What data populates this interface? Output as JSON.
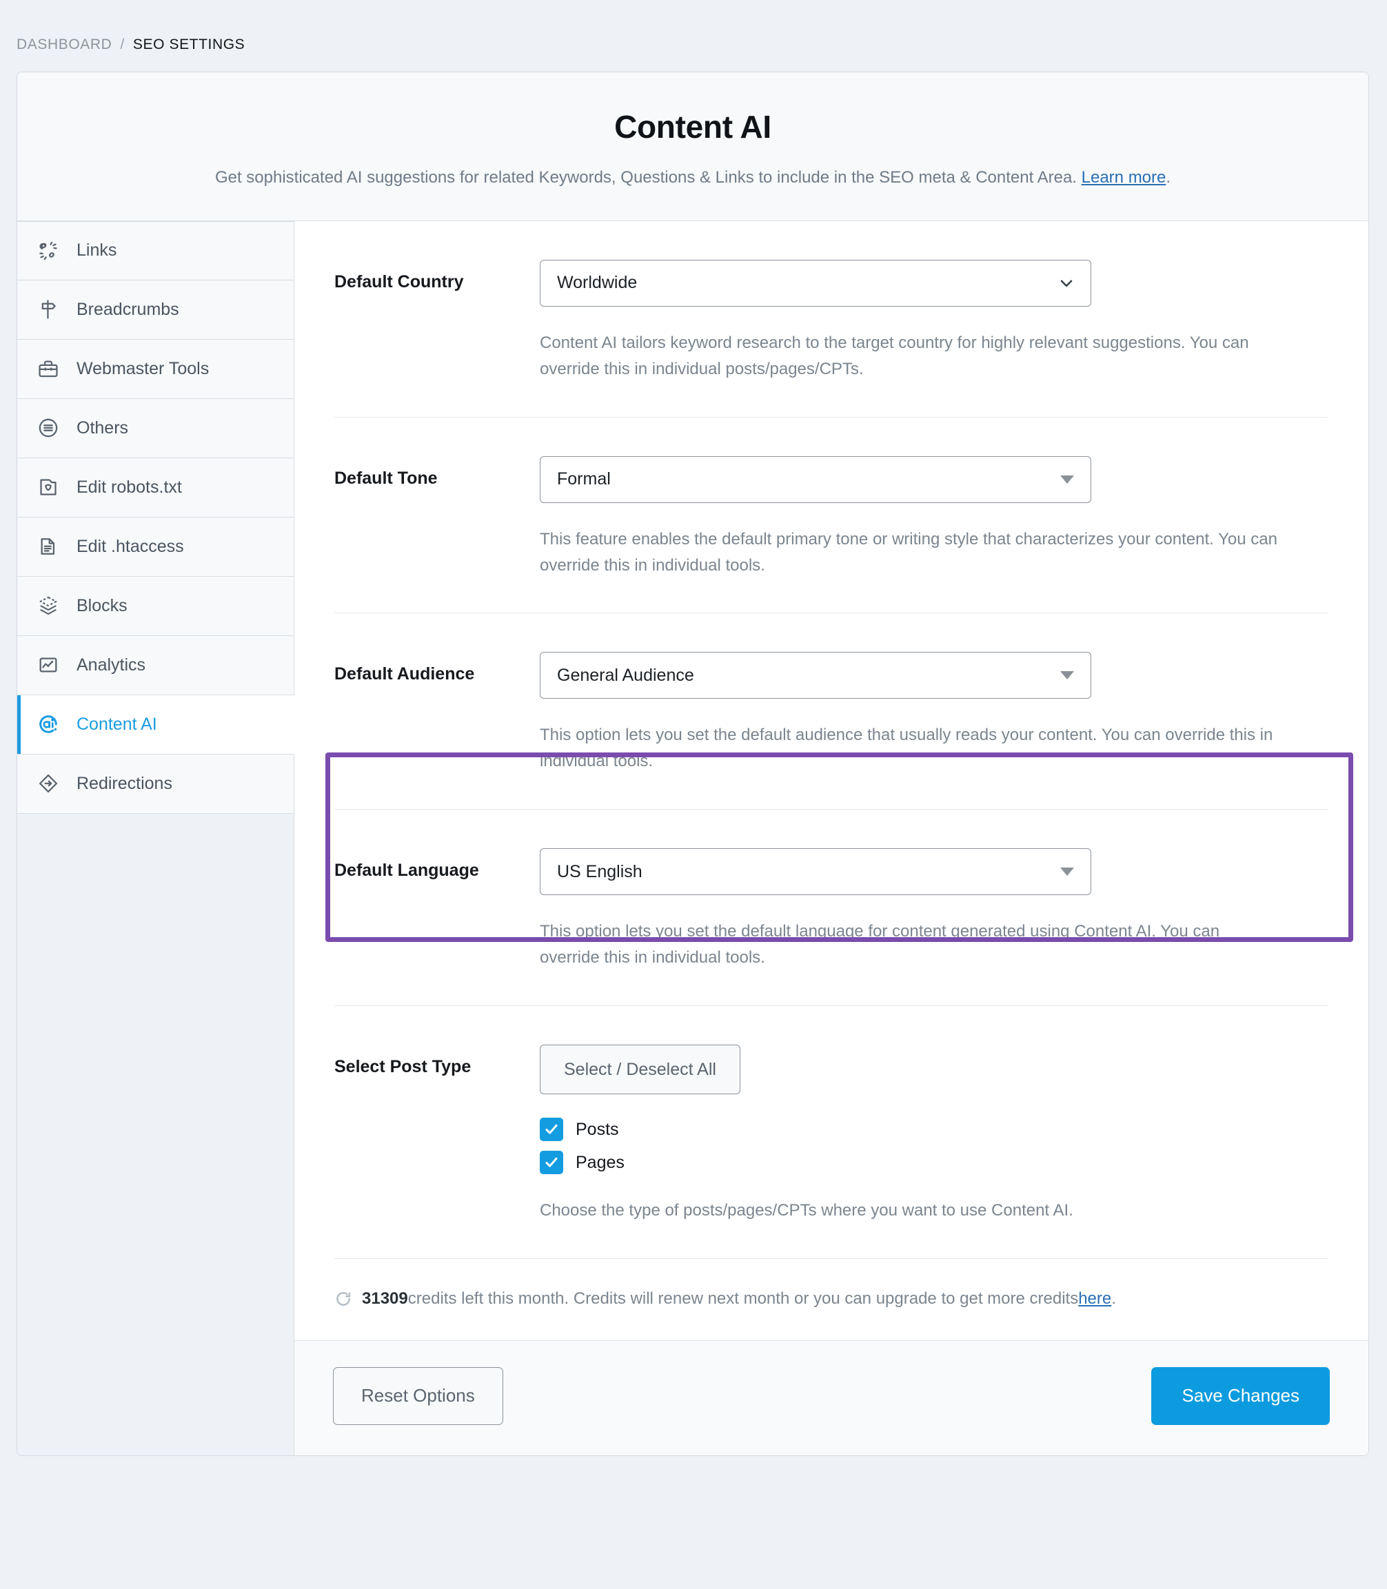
{
  "breadcrumb": {
    "parent": "DASHBOARD",
    "separator": "/",
    "current": "SEO SETTINGS"
  },
  "header": {
    "title": "Content AI",
    "description_before": "Get sophisticated AI suggestions for related Keywords, Questions & Links to include in the SEO meta & Content Area. ",
    "link_label": "Learn more",
    "description_after": "."
  },
  "sidebar": {
    "items": [
      {
        "label": "Links",
        "icon": "links-icon",
        "active": false
      },
      {
        "label": "Breadcrumbs",
        "icon": "signpost-icon",
        "active": false
      },
      {
        "label": "Webmaster Tools",
        "icon": "toolbox-icon",
        "active": false
      },
      {
        "label": "Others",
        "icon": "list-circle-icon",
        "active": false
      },
      {
        "label": "Edit robots.txt",
        "icon": "robots-file-icon",
        "active": false
      },
      {
        "label": "Edit .htaccess",
        "icon": "document-file-icon",
        "active": false
      },
      {
        "label": "Blocks",
        "icon": "layers-icon",
        "active": false
      },
      {
        "label": "Analytics",
        "icon": "analytics-chart-icon",
        "active": false
      },
      {
        "label": "Content AI",
        "icon": "content-ai-icon",
        "active": true
      },
      {
        "label": "Redirections",
        "icon": "redirect-arrow-icon",
        "active": false
      }
    ]
  },
  "fields": {
    "country": {
      "label": "Default Country",
      "value": "Worldwide",
      "help": "Content AI tailors keyword research to the target country for highly relevant suggestions. You can override this in individual posts/pages/CPTs."
    },
    "tone": {
      "label": "Default Tone",
      "value": "Formal",
      "help": "This feature enables the default primary tone or writing style that characterizes your content. You can override this in individual tools."
    },
    "audience": {
      "label": "Default Audience",
      "value": "General Audience",
      "help": "This option lets you set the default audience that usually reads your content. You can override this in individual tools."
    },
    "language": {
      "label": "Default Language",
      "value": "US English",
      "help": "This option lets you set the default language for content generated using Content AI. You can override this in individual tools."
    },
    "post_type": {
      "label": "Select Post Type",
      "select_all_label": "Select / Deselect All",
      "options": [
        {
          "label": "Posts",
          "checked": true
        },
        {
          "label": "Pages",
          "checked": true
        }
      ],
      "help": "Choose the type of posts/pages/CPTs where you want to use Content AI."
    }
  },
  "credits": {
    "amount": "31309",
    "text_before": " credits left this month. Credits will renew next month or you can upgrade to get more credits ",
    "link_label": "here",
    "text_after": "."
  },
  "footer": {
    "reset_label": "Reset Options",
    "save_label": "Save Changes"
  },
  "colors": {
    "accent": "#0d9bdf",
    "highlight": "#7a4cad",
    "link": "#2a6fb5",
    "page_bg": "#eef1f5"
  }
}
